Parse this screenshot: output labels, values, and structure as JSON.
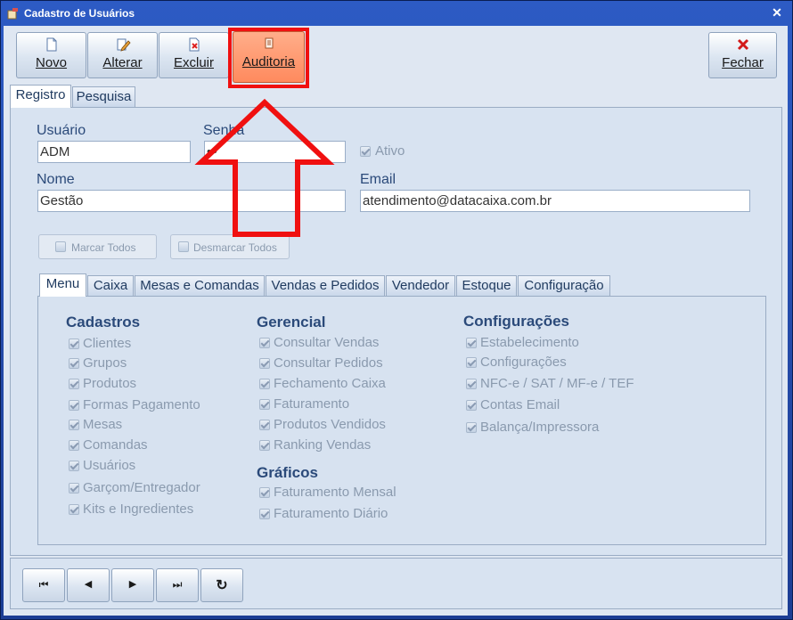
{
  "window": {
    "title": "Cadastro de Usuários",
    "close_glyph": "✕"
  },
  "toolbar": {
    "novo": "Novo",
    "alterar": "Alterar",
    "excluir": "Excluir",
    "auditoria": "Auditoria",
    "fechar": "Fechar"
  },
  "main_tabs": [
    "Registro",
    "Pesquisa"
  ],
  "form": {
    "usuario_label": "Usuário",
    "usuario_value": "ADM",
    "senha_label": "Senha",
    "senha_value": "•••",
    "ativo_label": "Ativo",
    "nome_label": "Nome",
    "nome_value": "Gestão",
    "email_label": "Email",
    "email_value": "atendimento@datacaixa.com.br",
    "marcar_todos": "Marcar Todos",
    "desmarcar_todos": "Desmarcar Todos"
  },
  "perm_tabs": [
    "Menu",
    "Caixa",
    "Mesas e Comandas",
    "Vendas e Pedidos",
    "Vendedor",
    "Estoque",
    "Configuração"
  ],
  "menu": {
    "cadastros": {
      "title": "Cadastros",
      "items": [
        "Clientes",
        "Grupos",
        "Produtos",
        "Formas Pagamento",
        "Mesas",
        "Comandas",
        "Usuários",
        "Garçom/Entregador",
        "Kits e Ingredientes"
      ]
    },
    "gerencial": {
      "title": "Gerencial",
      "items": [
        "Consultar Vendas",
        "Consultar Pedidos",
        "Fechamento Caixa",
        "Faturamento",
        "Produtos Vendidos",
        "Ranking Vendas"
      ]
    },
    "graficos": {
      "title": "Gráficos",
      "items": [
        "Faturamento Mensal",
        "Faturamento Diário"
      ]
    },
    "configuracoes": {
      "title": "Configurações",
      "items": [
        "Estabelecimento",
        "Configurações",
        "NFC-e / SAT / MF-e / TEF",
        "Contas Email",
        "Balança/Impressora"
      ]
    }
  },
  "navigator": {
    "first": "⏮",
    "prev": "◀",
    "next": "▶",
    "last": "⏭",
    "refresh": "↻"
  },
  "colors": {
    "highlight": "#f01010",
    "accent": "#ff8a5e"
  }
}
